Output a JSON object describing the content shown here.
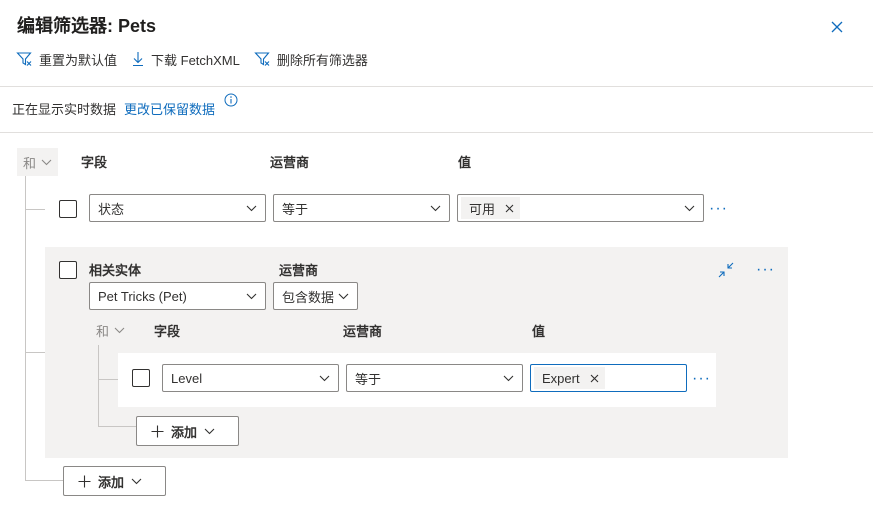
{
  "header": {
    "title": "编辑筛选器: Pets",
    "close_icon": "close-icon"
  },
  "toolbar": {
    "reset_label": "重置为默认值",
    "download_label": "下载 FetchXML",
    "delete_label": "删除所有筛选器"
  },
  "status": {
    "showing_text": "正在显示实时数据",
    "change_link": "更改已保留数据"
  },
  "filter": {
    "and_label": "和",
    "col_field": "字段",
    "col_operator": "运营商",
    "col_value": "值",
    "row1": {
      "field": "状态",
      "operator": "等于",
      "value_tag": "可用"
    },
    "group": {
      "related_label": "相关实体",
      "operator_label": "运营商",
      "entity_value": "Pet Tricks (Pet)",
      "entity_operator": "包含数据",
      "and_label": "和",
      "col_field": "字段",
      "col_operator": "运营商",
      "col_value": "值",
      "row": {
        "field": "Level",
        "operator": "等于",
        "value_tag": "Expert"
      },
      "add_label": "添加"
    },
    "add_label": "添加"
  },
  "colors": {
    "accent": "#0f6cbd",
    "group_bg": "#f3f2f1",
    "border": "#8a8886"
  }
}
